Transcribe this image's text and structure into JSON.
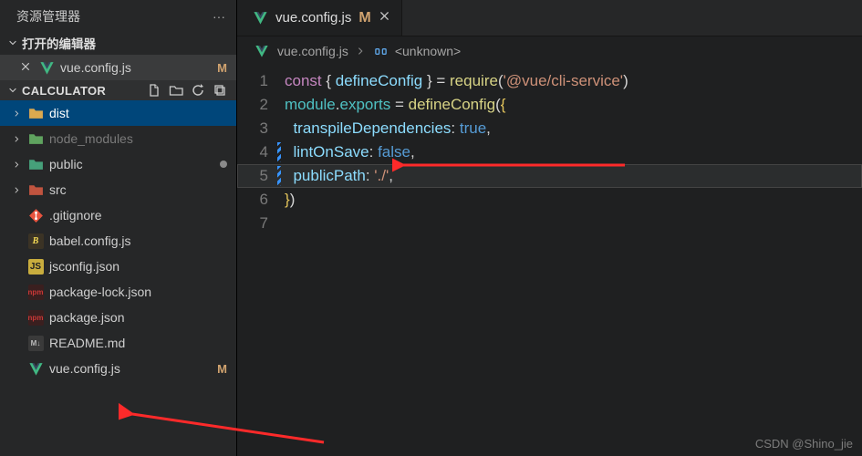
{
  "panelTitle": "资源管理器",
  "moreGlyph": "···",
  "openEditors": {
    "title": "打开的编辑器"
  },
  "openTab": {
    "file": "vue.config.js",
    "modified": "M"
  },
  "project": {
    "name": "CALCULATOR",
    "children": [
      {
        "name": "dist",
        "type": "folder",
        "selected": true
      },
      {
        "name": "node_modules",
        "type": "folder",
        "dim": true
      },
      {
        "name": "public",
        "type": "folder",
        "dot": true
      },
      {
        "name": "src",
        "type": "folder"
      },
      {
        "name": ".gitignore",
        "type": "file",
        "icon": "git"
      },
      {
        "name": "babel.config.js",
        "type": "file",
        "icon": "babel"
      },
      {
        "name": "jsconfig.json",
        "type": "file",
        "icon": "js"
      },
      {
        "name": "package-lock.json",
        "type": "file",
        "icon": "npm"
      },
      {
        "name": "package.json",
        "type": "file",
        "icon": "npm"
      },
      {
        "name": "README.md",
        "type": "file",
        "icon": "md"
      },
      {
        "name": "vue.config.js",
        "type": "file",
        "icon": "vue",
        "modified": "M"
      }
    ]
  },
  "tab": {
    "file": "vue.config.js",
    "modified": "M"
  },
  "breadcrumb": {
    "file": "vue.config.js",
    "symbol": "<unknown>"
  },
  "code": {
    "currentLine": 5,
    "lines": [
      {
        "n": 1,
        "seg": [
          {
            "c": "k-kw",
            "t": "const"
          },
          {
            "c": "k-pu",
            "t": " { "
          },
          {
            "c": "k-var",
            "t": "defineConfig"
          },
          {
            "c": "k-pu",
            "t": " } = "
          },
          {
            "c": "k-fn",
            "t": "require"
          },
          {
            "c": "k-pu",
            "t": "("
          },
          {
            "c": "k-str",
            "t": "'@vue/cli-service'"
          },
          {
            "c": "k-pu",
            "t": ")"
          }
        ]
      },
      {
        "n": 2,
        "seg": [
          {
            "c": "k-mod",
            "t": "module"
          },
          {
            "c": "k-pu",
            "t": "."
          },
          {
            "c": "k-mod",
            "t": "exports"
          },
          {
            "c": "k-pu",
            "t": " = "
          },
          {
            "c": "k-fn",
            "t": "defineConfig"
          },
          {
            "c": "k-pu",
            "t": "("
          },
          {
            "c": "k-gold",
            "t": "{"
          }
        ]
      },
      {
        "n": 3,
        "seg": [
          {
            "c": "",
            "t": "  "
          },
          {
            "c": "k-var",
            "t": "transpileDependencies"
          },
          {
            "c": "k-pu",
            "t": ": "
          },
          {
            "c": "k-num",
            "t": "true"
          },
          {
            "c": "k-pu",
            "t": ","
          }
        ]
      },
      {
        "n": 4,
        "chg": true,
        "seg": [
          {
            "c": "",
            "t": "  "
          },
          {
            "c": "k-var",
            "t": "lintOnSave"
          },
          {
            "c": "k-pu",
            "t": ": "
          },
          {
            "c": "k-num",
            "t": "false"
          },
          {
            "c": "k-pu",
            "t": ","
          }
        ]
      },
      {
        "n": 5,
        "chg": true,
        "seg": [
          {
            "c": "",
            "t": "  "
          },
          {
            "c": "k-var",
            "t": "publicPath"
          },
          {
            "c": "k-pu",
            "t": ": "
          },
          {
            "c": "k-str",
            "t": "'./'"
          },
          {
            "c": "k-pu",
            "t": ","
          }
        ]
      },
      {
        "n": 6,
        "seg": [
          {
            "c": "k-gold",
            "t": "}"
          },
          {
            "c": "k-pu",
            "t": ")"
          }
        ]
      },
      {
        "n": 7,
        "seg": [
          {
            "c": "",
            "t": ""
          }
        ]
      }
    ]
  },
  "watermark": "CSDN @Shino_jie"
}
